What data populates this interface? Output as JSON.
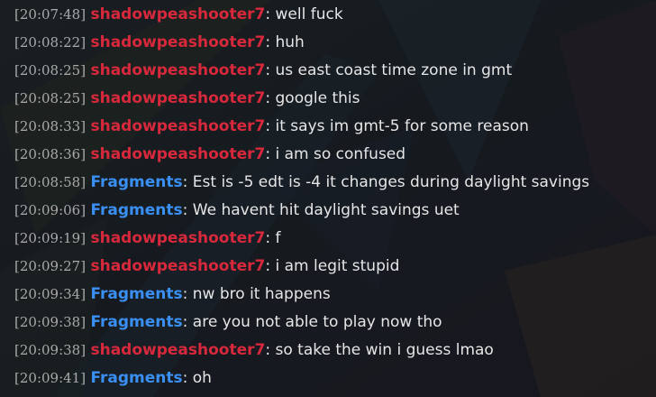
{
  "colors": {
    "background_overlay": "#18181c",
    "timestamp": "#a9a9a9",
    "message_text": "#e6e6e6"
  },
  "users": {
    "shadowpeashooter7": {
      "color": "#d8283c"
    },
    "Fragments": {
      "color": "#3a8ff2"
    }
  },
  "messages": [
    {
      "time": "[20:07:48]",
      "user": "shadowpeashooter7",
      "text": "well fuck"
    },
    {
      "time": "[20:08:22]",
      "user": "shadowpeashooter7",
      "text": "huh"
    },
    {
      "time": "[20:08:25]",
      "user": "shadowpeashooter7",
      "text": "us east coast time zone in gmt"
    },
    {
      "time": "[20:08:25]",
      "user": "shadowpeashooter7",
      "text": "google this"
    },
    {
      "time": "[20:08:33]",
      "user": "shadowpeashooter7",
      "text": "it says im gmt-5 for some reason"
    },
    {
      "time": "[20:08:36]",
      "user": "shadowpeashooter7",
      "text": "i am so confused"
    },
    {
      "time": "[20:08:58]",
      "user": "Fragments",
      "text": "Est is -5 edt is -4 it changes during daylight savings"
    },
    {
      "time": "[20:09:06]",
      "user": "Fragments",
      "text": "We havent hit daylight savings uet"
    },
    {
      "time": "[20:09:19]",
      "user": "shadowpeashooter7",
      "text": "f"
    },
    {
      "time": "[20:09:27]",
      "user": "shadowpeashooter7",
      "text": "i am legit stupid"
    },
    {
      "time": "[20:09:34]",
      "user": "Fragments",
      "text": "nw bro it happens"
    },
    {
      "time": "[20:09:38]",
      "user": "Fragments",
      "text": "are you not able to play now tho"
    },
    {
      "time": "[20:09:38]",
      "user": "shadowpeashooter7",
      "text": "so take the win i guess lmao"
    },
    {
      "time": "[20:09:41]",
      "user": "Fragments",
      "text": "oh"
    }
  ]
}
